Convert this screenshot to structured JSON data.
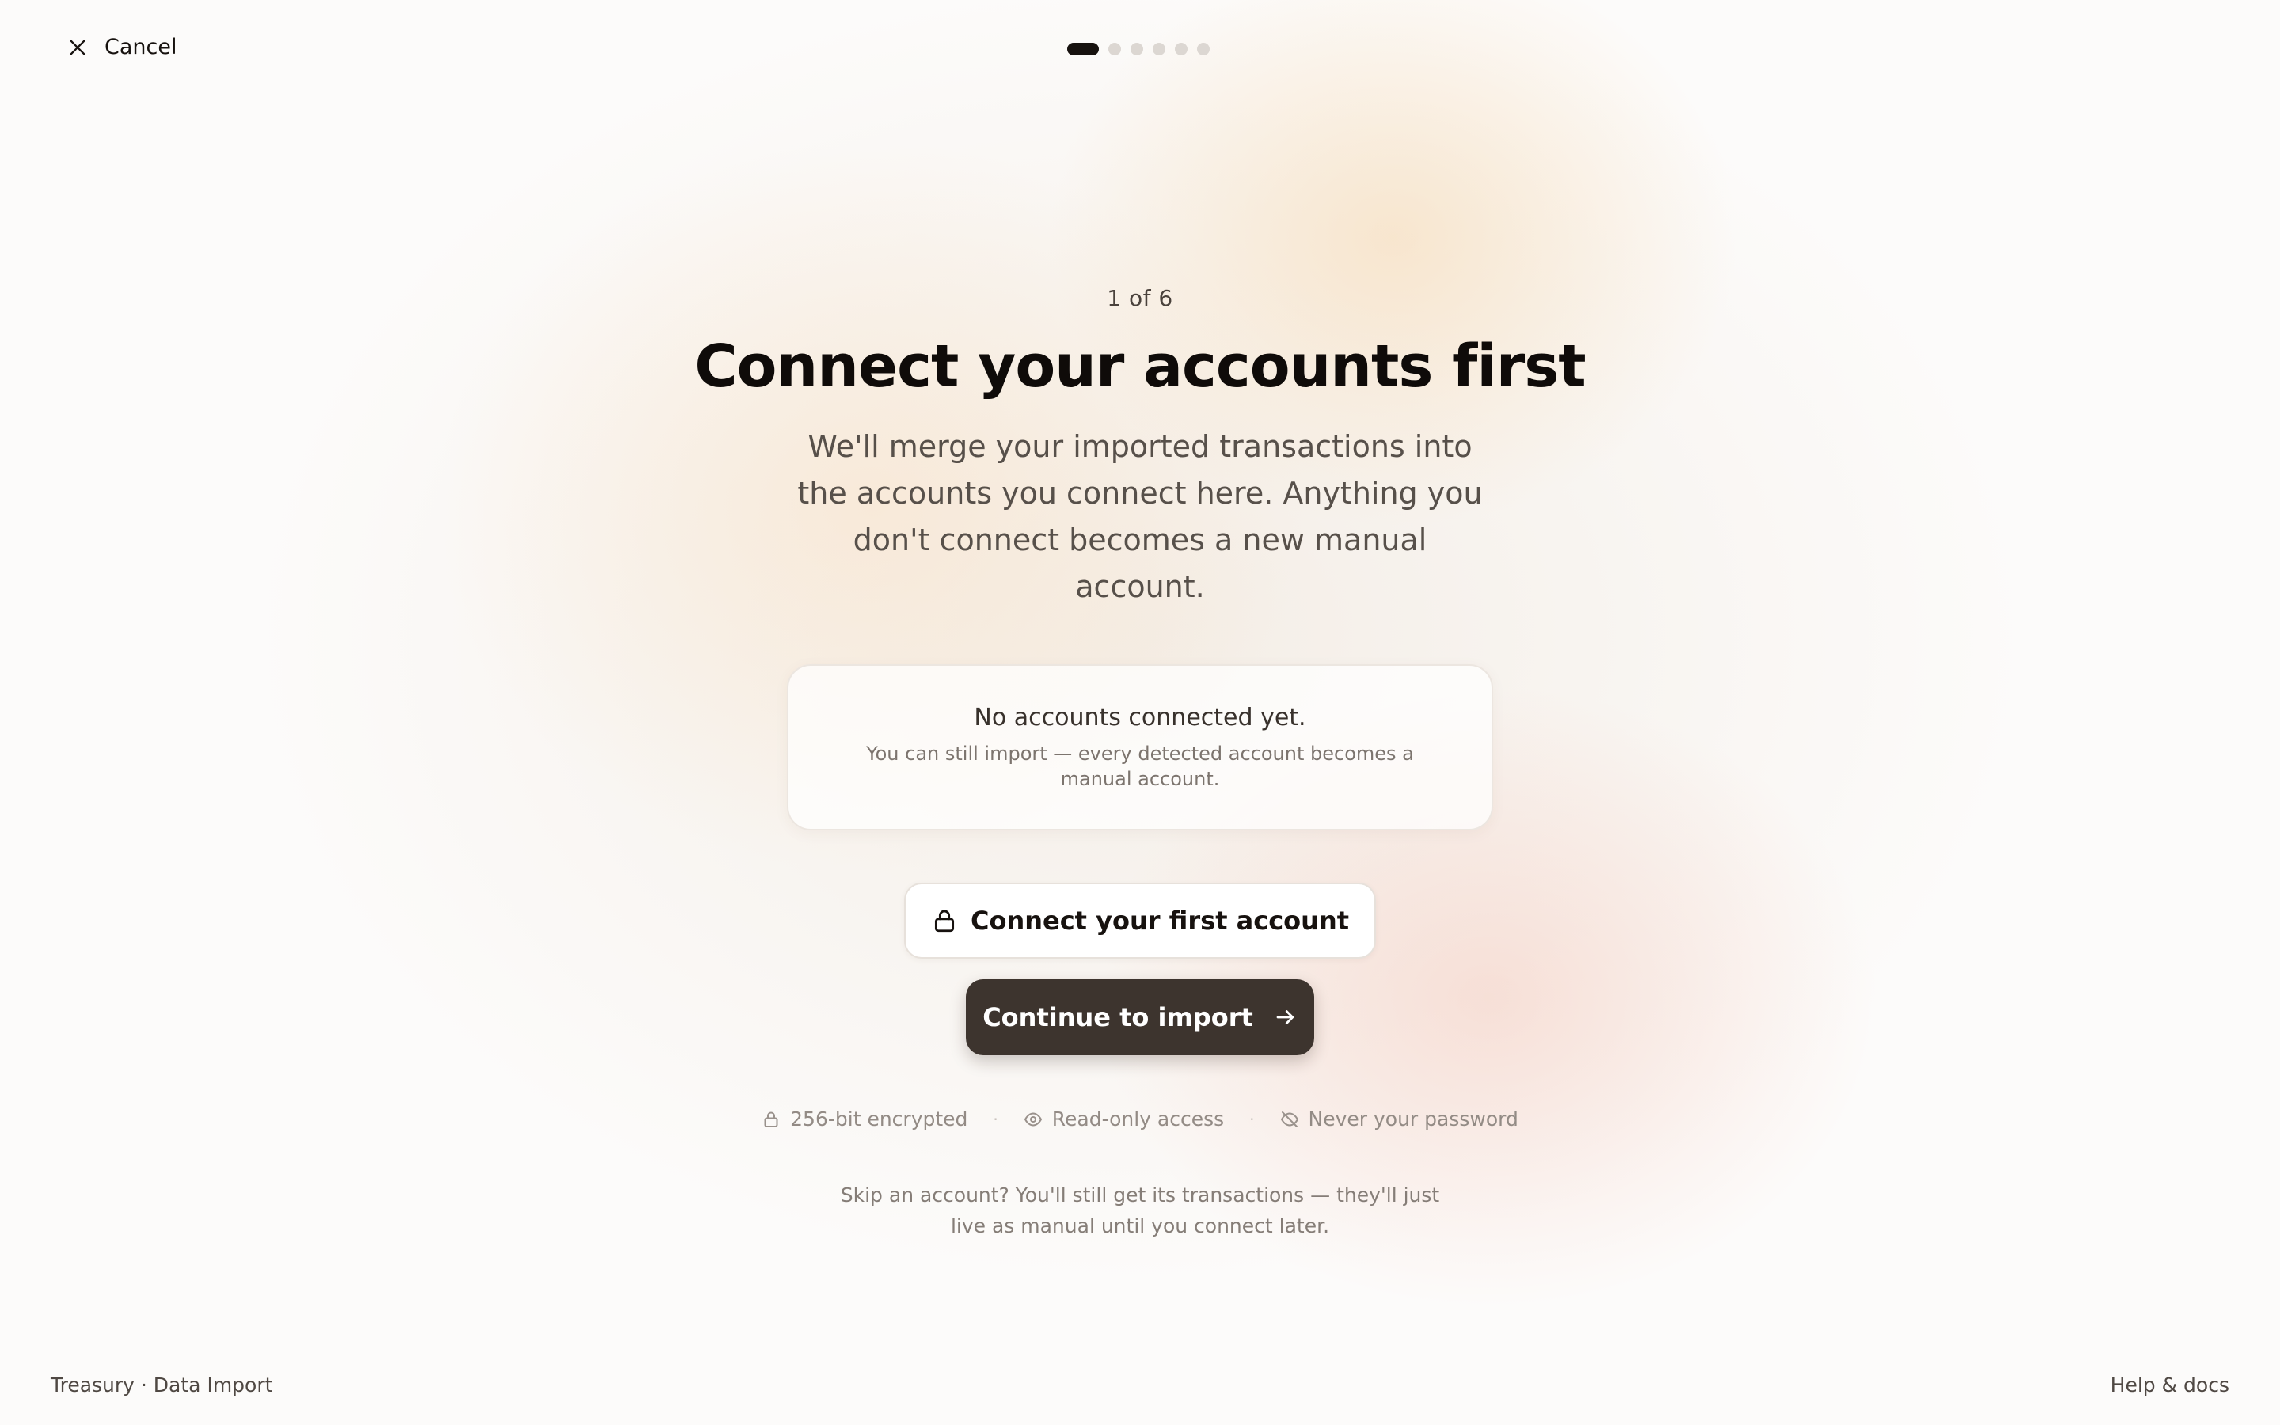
{
  "header": {
    "cancel_label": "Cancel",
    "stepper": {
      "total_steps": 6,
      "current_step": 1
    }
  },
  "main": {
    "step_label": "1 of 6",
    "title": "Connect your accounts first",
    "subtitle": "We'll merge your imported transactions into the accounts you connect here. Anything you don't connect becomes a new manual account.",
    "empty_state": {
      "title": "No accounts connected yet.",
      "description": "You can still import — every detected account becomes a manual account."
    },
    "connect_button_label": "Connect your first account",
    "continue_button_label": "Continue to import",
    "trust_badges": [
      {
        "icon": "lock-icon",
        "label": "256-bit encrypted"
      },
      {
        "icon": "eye-icon",
        "label": "Read-only access"
      },
      {
        "icon": "eye-off-icon",
        "label": "Never your password"
      }
    ],
    "skip_note": "Skip an account? You'll still get its transactions — they'll just live as manual until you connect later."
  },
  "footer": {
    "breadcrumb": "Treasury · Data Import",
    "help_link": "Help & docs"
  },
  "colors": {
    "primary_button": "#3d342e",
    "active_step": "#17120f",
    "inactive_step": "#dcd7d2"
  }
}
